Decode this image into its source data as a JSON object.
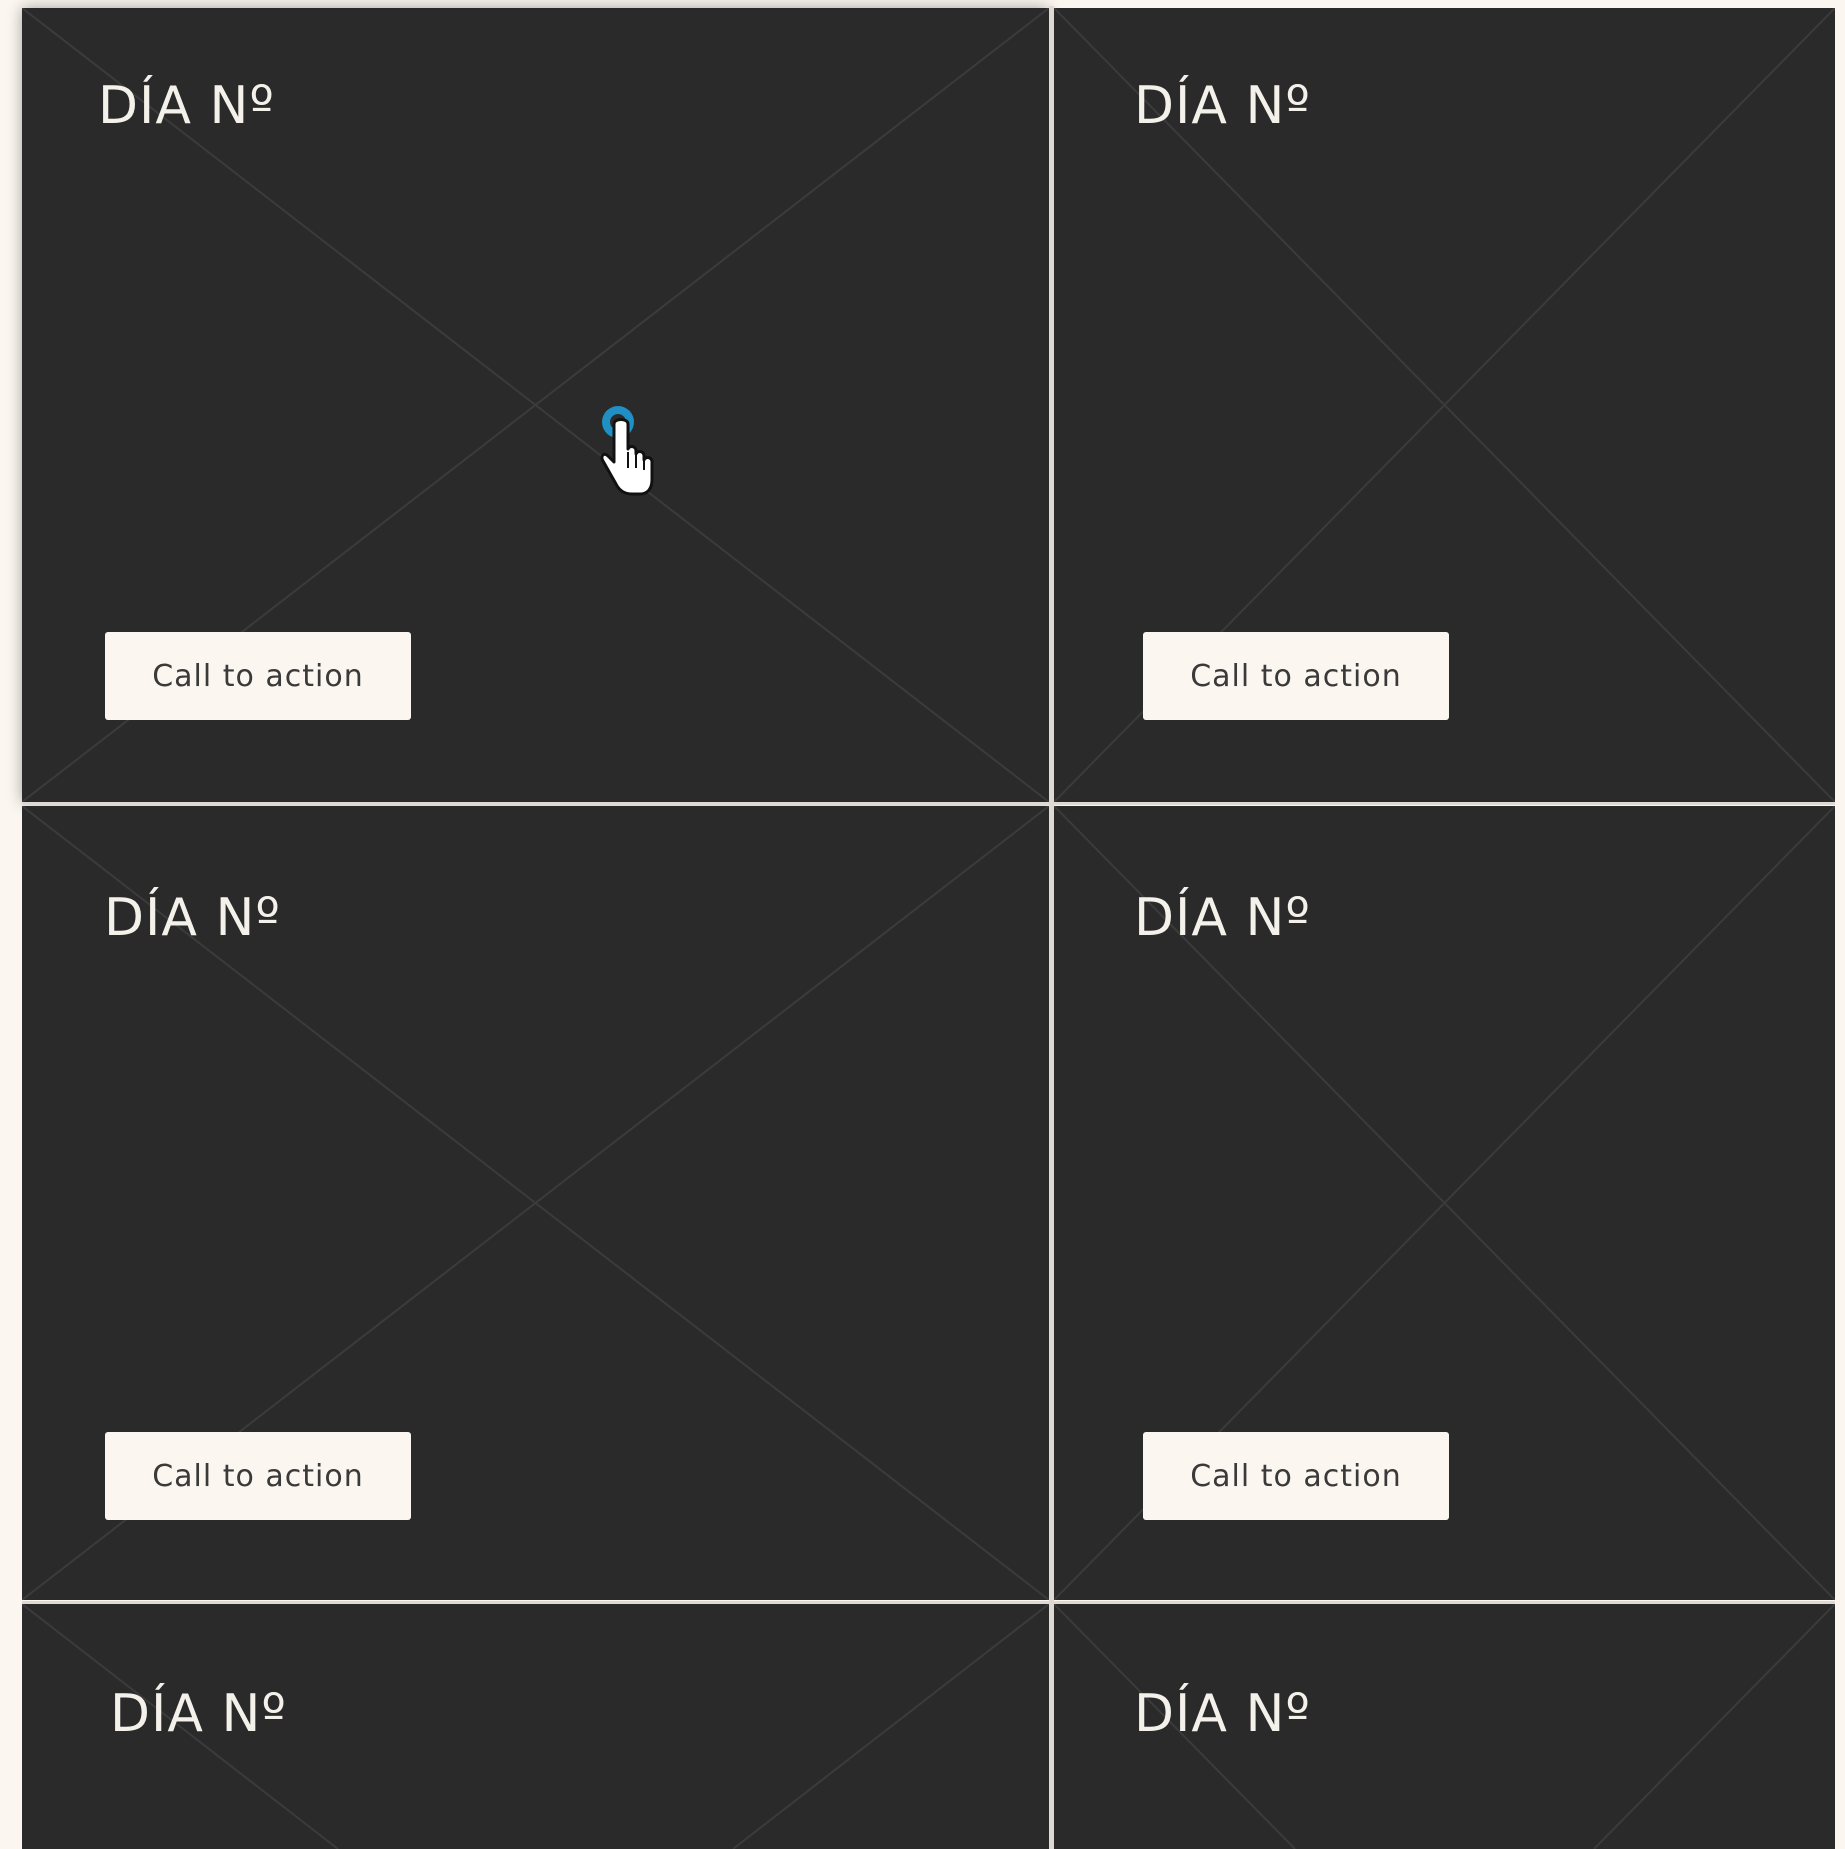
{
  "cards": [
    {
      "title": "DÍA Nº",
      "cta_label": "Call to action"
    },
    {
      "title": "DÍA Nº",
      "cta_label": "Call to action"
    },
    {
      "title": "DÍA Nº",
      "cta_label": "Call to action"
    },
    {
      "title": "DÍA Nº",
      "cta_label": "Call to action"
    },
    {
      "title": "DÍA Nº"
    },
    {
      "title": "DÍA Nº"
    }
  ],
  "colors": {
    "card_background": "#2a2a2b",
    "page_background": "#fbf7f0",
    "cursor_accent": "#1f8fc4"
  },
  "icons": {
    "placeholder": "image-placeholder-x-icon",
    "cursor": "hand-pointer-cursor-icon"
  }
}
